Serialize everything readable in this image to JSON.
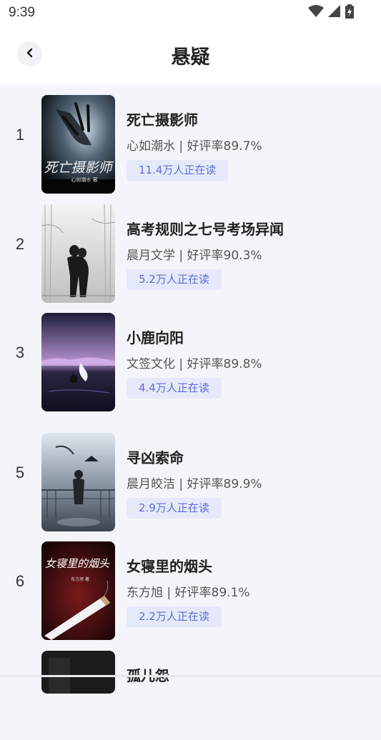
{
  "status_bar": {
    "time": "9:39"
  },
  "header": {
    "title": "悬疑"
  },
  "books": [
    {
      "rank": "1",
      "title": "死亡摄影师",
      "author": "心如潮水",
      "rating": "好评率89.7%",
      "readers": "11.4万人正在读",
      "cover_text": "死亡摄影师",
      "cover_sub": "心如潮水 著"
    },
    {
      "rank": "2",
      "title": "高考规则之七号考场异闻",
      "author": "晨月文学",
      "rating": "好评率90.3%",
      "readers": "5.2万人正在读"
    },
    {
      "rank": "3",
      "title": "小鹿向阳",
      "author": "文签文化",
      "rating": "好评率89.8%",
      "readers": "4.4万人正在读"
    },
    {
      "rank": "5",
      "title": "寻凶索命",
      "author": "晨月皎洁",
      "rating": "好评率89.9%",
      "readers": "2.9万人正在读"
    },
    {
      "rank": "6",
      "title": "女寝里的烟头",
      "author": "东方旭",
      "rating": "好评率89.1%",
      "readers": "2.2万人正在读",
      "cover_text": "女寝里的烟头",
      "cover_sub": "东方旭 著"
    },
    {
      "rank": "",
      "title": "孤儿怨",
      "author": "",
      "rating": "",
      "readers": ""
    }
  ],
  "colors": {
    "accent": "#5a70d6",
    "badge_bg": "#e6e9fa",
    "page_bg": "#f4f5fa"
  },
  "icons": [
    "back-arrow-icon",
    "wifi-icon",
    "signal-icon",
    "battery-icon"
  ]
}
